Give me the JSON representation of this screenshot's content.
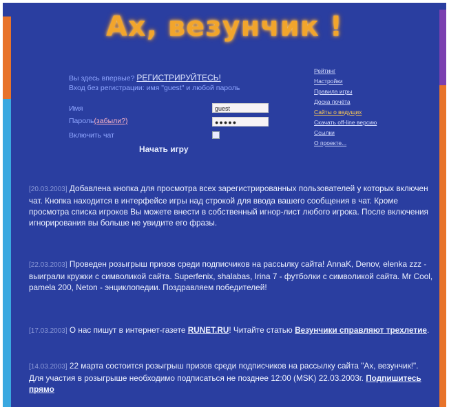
{
  "title": "Ах, везунчик !",
  "login": {
    "first_time_prefix": "Вы здесь впервые?",
    "register_link": "РЕГИСТРИРУЙТЕСЬ!",
    "guest_note": "Вход без регистрации: имя \"guest\" и любой пароль",
    "name_label": "Имя",
    "password_label": "Пароль",
    "forgot_link": "(забыли?)",
    "chat_label": "Включить чат",
    "name_value": "guest",
    "password_value": "●●●●●",
    "start_button": "Начать игру"
  },
  "side_links": [
    "Рейтинг",
    "Настройки",
    "Правила игры",
    "Доска почёта",
    "Сайты о ведущих",
    "Скачать off-line версию",
    "Ссылки",
    "О проекте..."
  ],
  "news": [
    {
      "date": "[20.03.2003]",
      "text": "Добавлена кнопка для просмотра всех зарегистрированных пользователей у которых включен чат. Кнопка находится в интерфейсе игры над строкой для ввода вашего сообщения в чат. Кроме просмотра списка игроков Вы можете внести в собственный игнор-лист любого игрока. После включения игнорирования вы больше не увидите его фразы."
    },
    {
      "date": "[22.03.2003]",
      "text": "Проведен розыгрыш призов среди подписчиков на рассылку сайта! AnnaK, Denov, elenka zzz - выиграли кружки с символикой сайта. Superfenix, shalabas, Irina 7 - футболки с символикой сайта. Mr Cool, pamela 200, Neton - энциклопедии. Поздравляем победителей!"
    },
    {
      "date": "[17.03.2003]",
      "prefix": "О нас пишут в интернет-газете",
      "link1": "RUNET.RU",
      "middle": "! Читайте статью",
      "link2": "Везунчики справляют трехлетие",
      "suffix": "."
    },
    {
      "date": "[14.03.2003]",
      "text": "22 марта состоится розыгрыш призов среди подписчиков на рассылку сайта \"Ах, везунчик!\". Для участия в розыгрыше необходимо подписаться не позднее 12:00 (MSK) 22.03.2003г.",
      "link": "Подпишитесь прямо"
    }
  ]
}
